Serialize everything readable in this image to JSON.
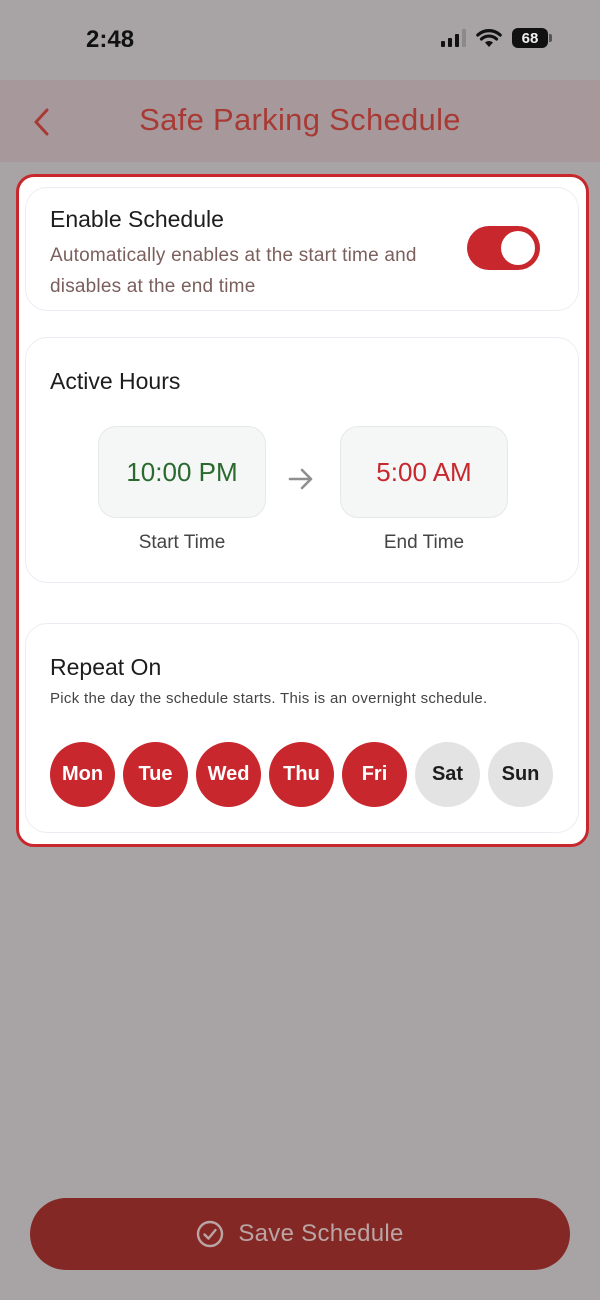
{
  "status_bar": {
    "time": "2:48",
    "battery": "68"
  },
  "header": {
    "title": "Safe Parking Schedule",
    "back_icon": "chevron-left-icon",
    "accent_color": "#a83a36"
  },
  "enable": {
    "title": "Enable Schedule",
    "description": "Automatically enables at the start time and disables at the end time",
    "enabled": true
  },
  "active_hours": {
    "title": "Active Hours",
    "start_time": "10:00 PM",
    "end_time": "5:00 AM",
    "start_label": "Start Time",
    "end_label": "End Time",
    "arrow_icon": "arrow-right-icon",
    "start_color": "#2a6a2f",
    "end_color": "#c8272d"
  },
  "repeat": {
    "title": "Repeat On",
    "description": "Pick the day the schedule starts. This is an overnight schedule.",
    "days": [
      {
        "label": "Mon",
        "selected": true
      },
      {
        "label": "Tue",
        "selected": true
      },
      {
        "label": "Wed",
        "selected": true
      },
      {
        "label": "Thu",
        "selected": true
      },
      {
        "label": "Fri",
        "selected": true
      },
      {
        "label": "Sat",
        "selected": false
      },
      {
        "label": "Sun",
        "selected": false
      }
    ]
  },
  "save": {
    "label": "Save Schedule",
    "icon": "check-circle-icon"
  },
  "colors": {
    "primary_red": "#c8272d",
    "save_button": "#842825",
    "overlay": "#a8a4a5"
  }
}
